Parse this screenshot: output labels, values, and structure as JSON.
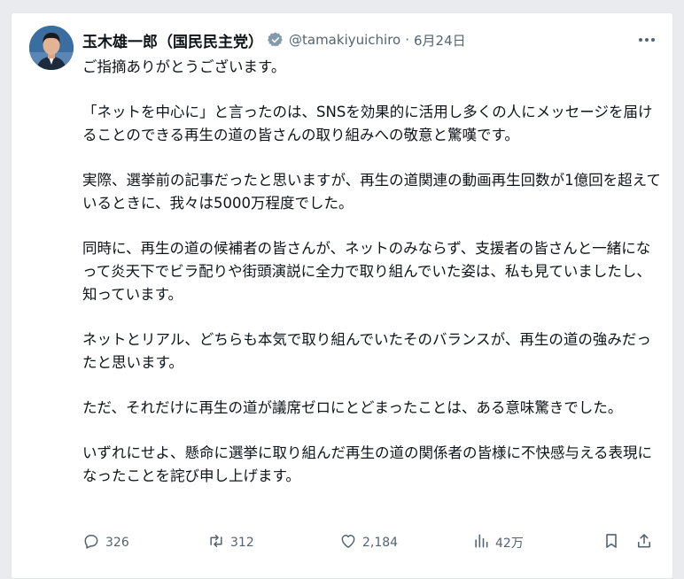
{
  "post": {
    "author_name": "玉木雄一郎（国民民主党）",
    "handle": "@tamakiyuichiro",
    "separator": "·",
    "date": "6月24日",
    "body": [
      "ご指摘ありがとうございます。",
      "「ネットを中心に」と言ったのは、SNSを効果的に活用し多くの人にメッセージを届けることのできる再生の道の皆さんの取り組みへの敬意と驚嘆です。",
      "実際、選挙前の記事だったと思いますが、再生の道関連の動画再生回数が1億回を超えているときに、我々は5000万程度でした。",
      "同時に、再生の道の候補者の皆さんが、ネットのみならず、支援者の皆さんと一緒になって炎天下でビラ配りや街頭演説に全力で取り組んでいた姿は、私も見ていましたし、知っています。",
      "ネットとリアル、どちらも本気で取り組んでいたそのバランスが、再生の道の強みだったと思います。",
      "ただ、それだけに再生の道が議席ゼロにとどまったことは、ある意味驚きでした。",
      "いずれにせよ、懸命に選挙に取り組んだ再生の道の関係者の皆様に不快感与える表現になったことを詫び申し上げます。"
    ],
    "stats": {
      "replies": "326",
      "reposts": "312",
      "likes": "2,184",
      "views": "42万"
    }
  },
  "icons": {
    "verified": "verified-badge-icon",
    "more": "more-options-icon",
    "reply": "reply-icon",
    "repost": "repost-icon",
    "like": "heart-icon",
    "views": "views-chart-icon",
    "bookmark": "bookmark-icon",
    "share": "share-icon"
  },
  "colors": {
    "text": "#0f1419",
    "secondary": "#536471",
    "verified_gray": "#829aab",
    "background": "#ffffff"
  }
}
